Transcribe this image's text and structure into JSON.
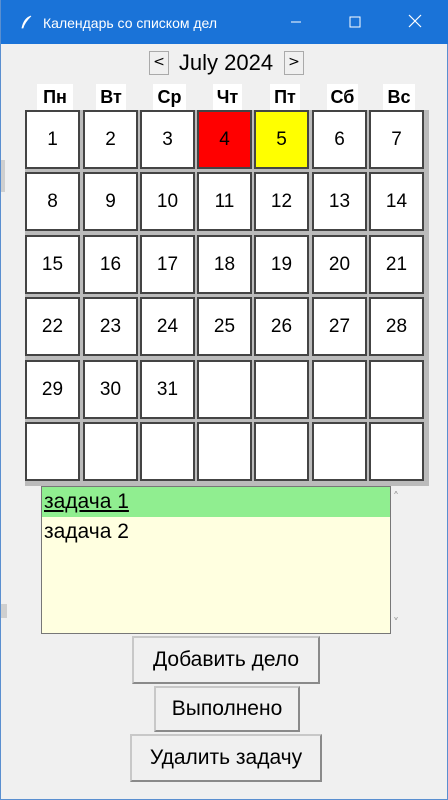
{
  "window": {
    "title": "Календарь со списком дел",
    "minimize_icon": "minimize-icon",
    "maximize_icon": "maximize-icon",
    "close_icon": "close-icon",
    "app_icon": "feather-icon",
    "titlebar_color": "#1a73d8"
  },
  "calendar": {
    "month_label": "July 2024",
    "prev_label": "<",
    "next_label": ">",
    "weekdays": [
      "Пн",
      "Вт",
      "Ср",
      "Чт",
      "Пт",
      "Сб",
      "Вс"
    ],
    "weeks": [
      [
        "1",
        "2",
        "3",
        "4",
        "5",
        "6",
        "7"
      ],
      [
        "8",
        "9",
        "10",
        "11",
        "12",
        "13",
        "14"
      ],
      [
        "15",
        "16",
        "17",
        "18",
        "19",
        "20",
        "21"
      ],
      [
        "22",
        "23",
        "24",
        "25",
        "26",
        "27",
        "28"
      ],
      [
        "29",
        "30",
        "31",
        "",
        "",
        "",
        ""
      ],
      [
        "",
        "",
        "",
        "",
        "",
        "",
        ""
      ]
    ],
    "highlights": {
      "4": "#ff0000",
      "5": "#ffff00"
    }
  },
  "tasks": {
    "items": [
      "задача 1",
      "задача 2"
    ],
    "selected_index": 0,
    "background_color": "#ffffe0",
    "selected_color": "#90ee90"
  },
  "buttons": {
    "add": "Добавить дело",
    "done": "Выполнено",
    "delete": "Удалить задачу"
  }
}
